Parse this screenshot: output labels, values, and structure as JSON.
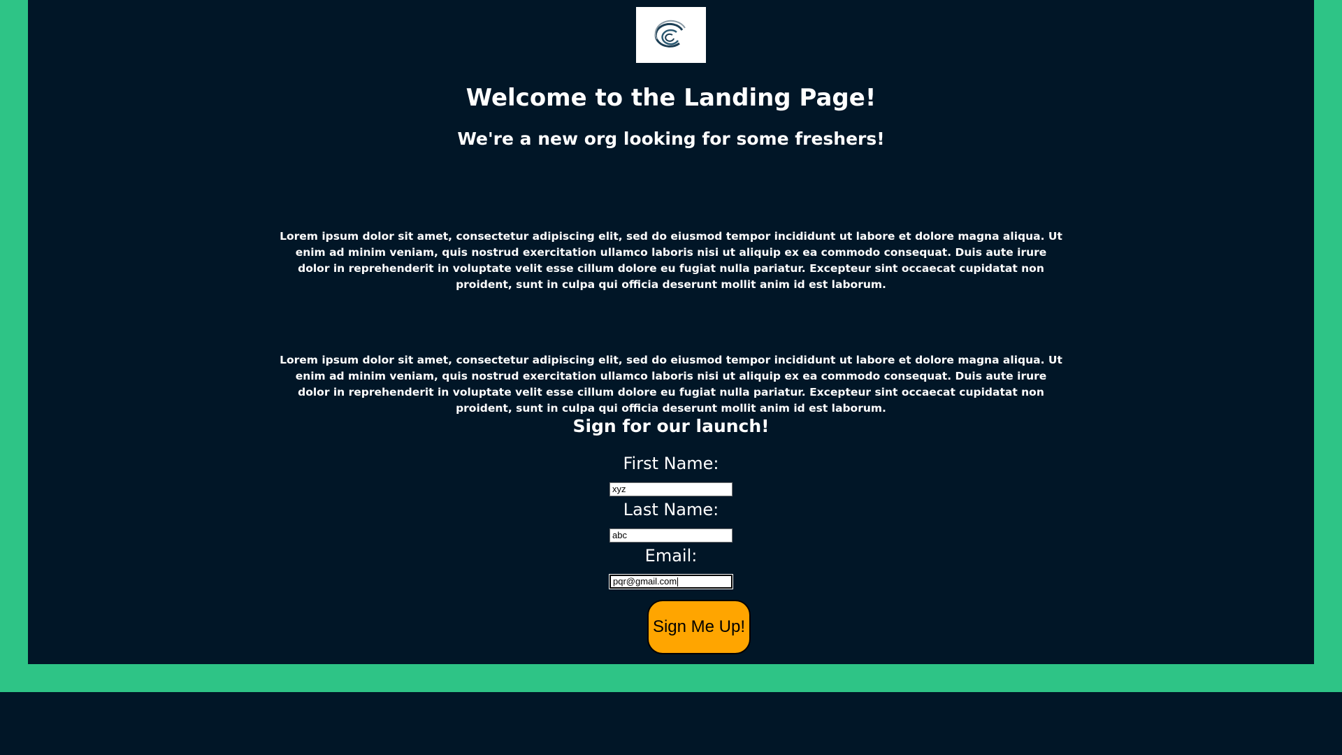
{
  "header": {
    "logo_icon": "swirl-logo-icon",
    "title": "Welcome to the Landing Page!",
    "subtitle": "We're a new org looking for some freshers!"
  },
  "content": {
    "paragraph_1": "Lorem ipsum dolor sit amet, consectetur adipiscing elit, sed do eiusmod tempor incididunt ut labore et dolore magna aliqua. Ut enim ad minim veniam, quis nostrud exercitation ullamco laboris nisi ut aliquip ex ea commodo consequat. Duis aute irure dolor in reprehenderit in voluptate velit esse cillum dolore eu fugiat nulla pariatur. Excepteur sint occaecat cupidatat non proident, sunt in culpa qui officia deserunt mollit anim id est laborum.",
    "paragraph_2": "Lorem ipsum dolor sit amet, consectetur adipiscing elit, sed do eiusmod tempor incididunt ut labore et dolore magna aliqua. Ut enim ad minim veniam, quis nostrud exercitation ullamco laboris nisi ut aliquip ex ea commodo consequat. Duis aute irure dolor in reprehenderit in voluptate velit esse cillum dolore eu fugiat nulla pariatur. Excepteur sint occaecat cupidatat non proident, sunt in culpa qui officia deserunt mollit anim id est laborum."
  },
  "form": {
    "heading": "Sign for our launch!",
    "first_name_label": "First Name:",
    "first_name_value": "xyz",
    "last_name_label": "Last Name:",
    "last_name_value": "abc",
    "email_label": "Email:",
    "email_value": "pqr@gmail.com",
    "submit_label": "Sign Me Up!"
  },
  "colors": {
    "frame": "#2ec486",
    "panel": "#011627",
    "text": "#ffffff",
    "button": "#ffa500"
  }
}
